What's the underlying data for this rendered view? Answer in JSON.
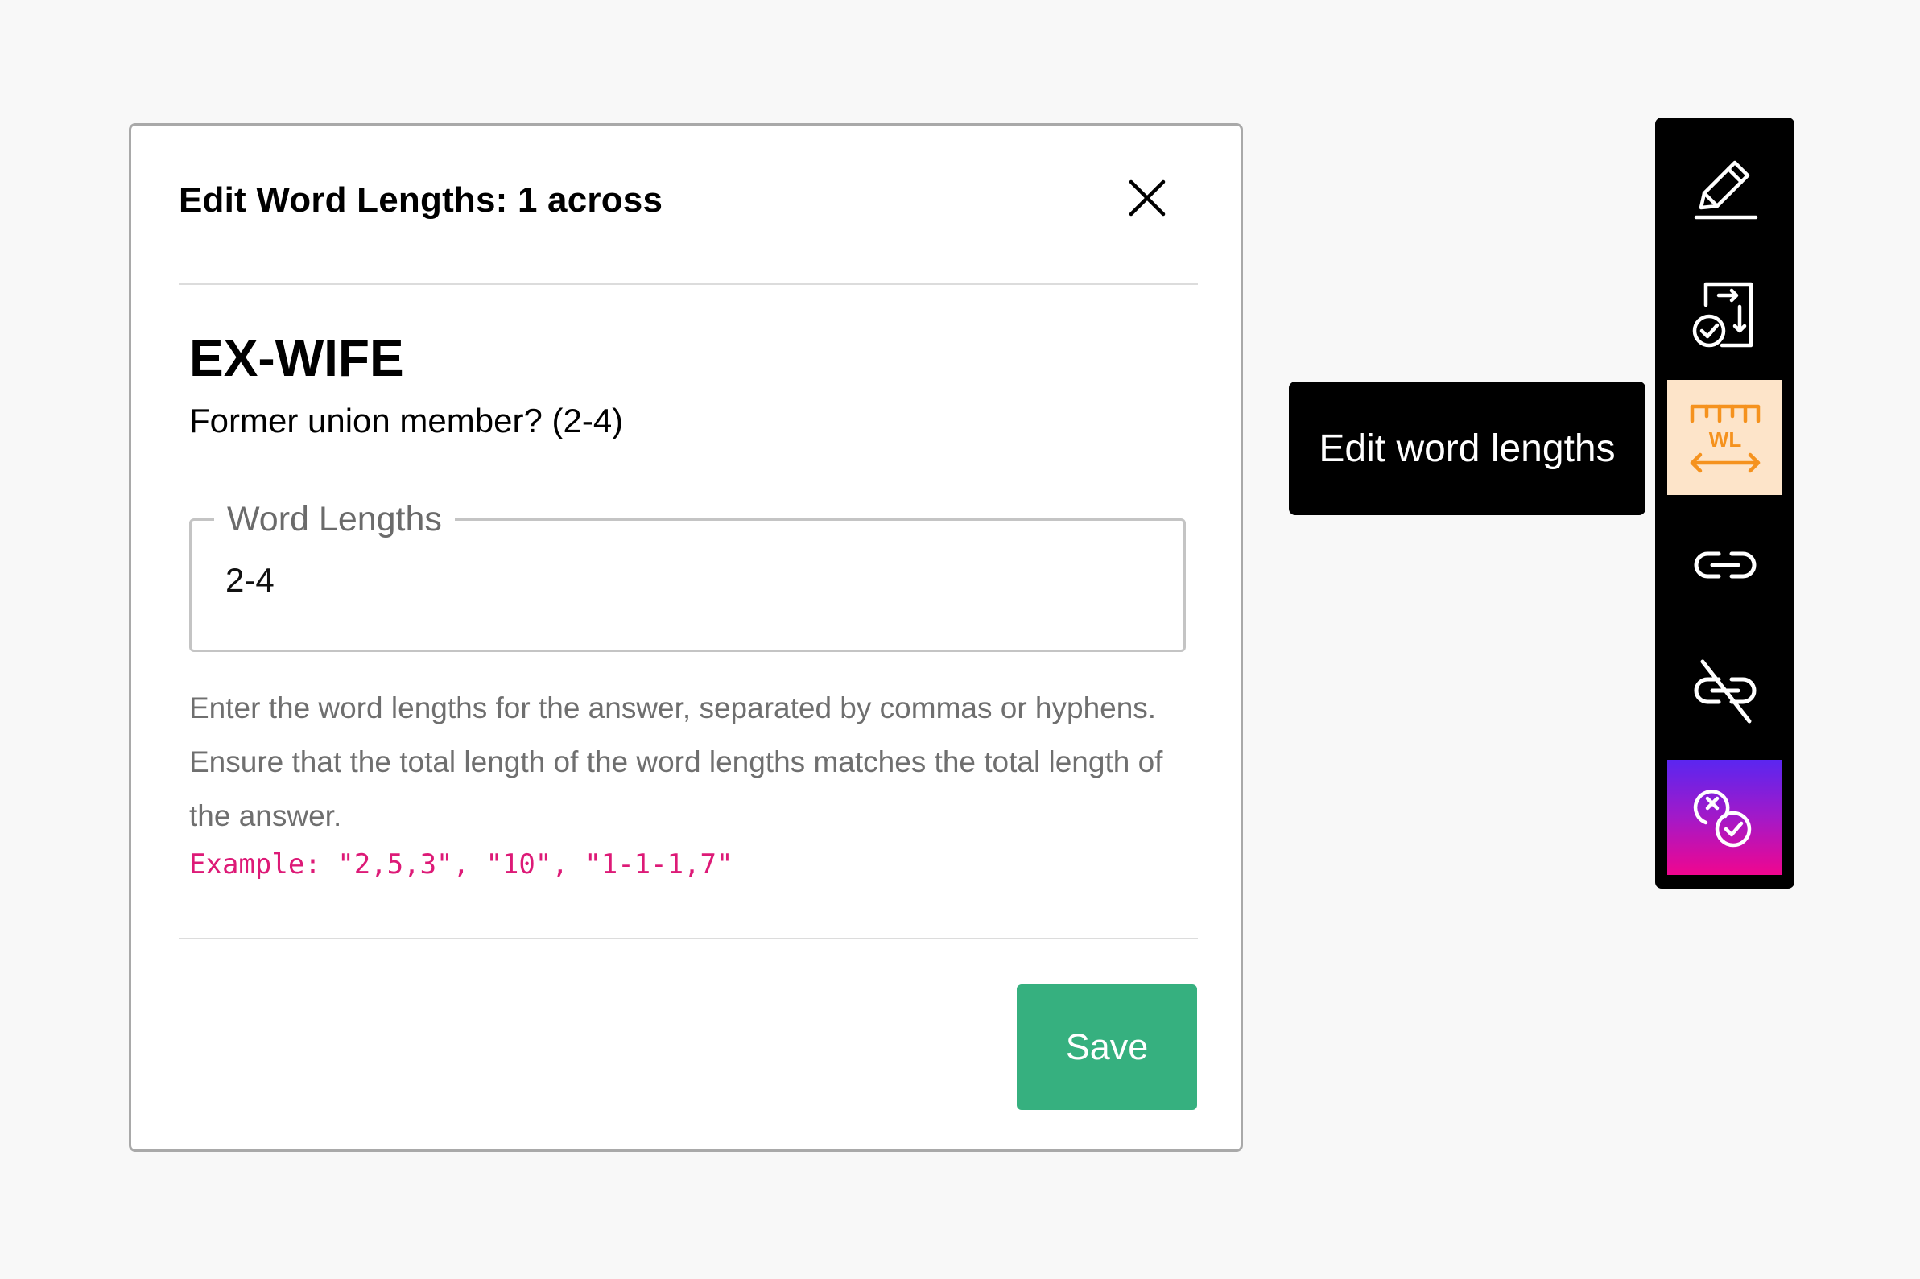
{
  "modal": {
    "title": "Edit Word Lengths: 1 across",
    "answer": "EX-WIFE",
    "clue": "Former union member? (2-4)",
    "field": {
      "label": "Word Lengths",
      "value": "2-4"
    },
    "help_text": "Enter the word lengths for the answer, separated by commas or hyphens. Ensure that the total length of the word lengths matches the total length of the answer.",
    "example": "Example: \"2,5,3\", \"10\", \"1-1-1,7\"",
    "save_label": "Save"
  },
  "tooltip": {
    "text": "Edit word lengths"
  },
  "toolbar": {
    "tools": [
      {
        "icon": "pencil-icon"
      },
      {
        "icon": "document-check-arrows-icon"
      },
      {
        "icon": "word-length-ruler-icon",
        "active": true,
        "label": "WL"
      },
      {
        "icon": "link-icon"
      },
      {
        "icon": "unlink-icon"
      },
      {
        "icon": "clear-check-icon"
      }
    ]
  },
  "colors": {
    "save_button": "#36b07f",
    "example_text": "#dd1a77",
    "active_tool_bg": "#fde4c9",
    "active_tool_icon": "#f5921e",
    "toolbar_bg": "#000000",
    "gradient_top": "#5a26f0",
    "gradient_bottom": "#f0068f"
  }
}
